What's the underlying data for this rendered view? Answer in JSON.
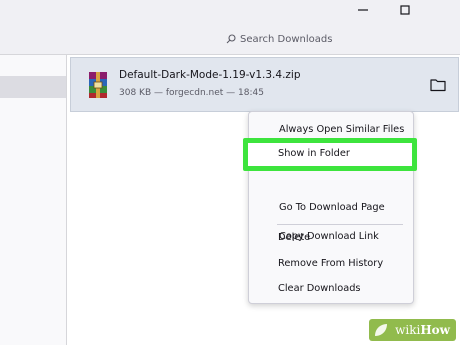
{
  "toolbar": {
    "search_placeholder": "Search Downloads"
  },
  "download": {
    "filename": "Default-Dark-Mode-1.19-v1.3.4.zip",
    "meta": "308 KB — forgecdn.net — 18:45"
  },
  "context_menu": {
    "items": [
      "Always Open Similar Files",
      "Show in Folder",
      "Go To Download Page",
      "Copy Download Link",
      "Delete",
      "Remove From History",
      "Clear Downloads"
    ]
  },
  "watermark": {
    "wiki": "wiki",
    "how": "How"
  },
  "colors": {
    "highlight": "#3de43d",
    "watermark_bg": "#86b43a"
  },
  "icons": [
    "minimize-icon",
    "maximize-icon",
    "search-icon",
    "archive-icon",
    "folder-icon"
  ]
}
